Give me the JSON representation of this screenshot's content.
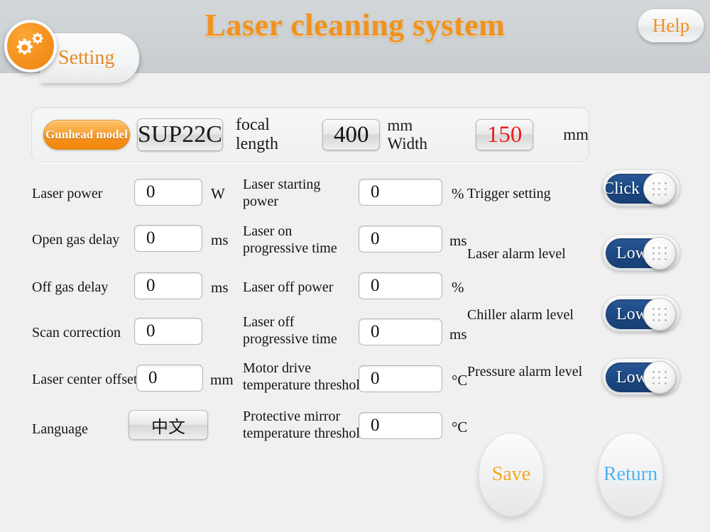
{
  "header": {
    "title": "Laser cleaning system",
    "help_label": "Help",
    "tab_label": "Setting",
    "gear_icon": "gears-icon",
    "accent_orange": "#f0921e",
    "bar_color": "#cdd2d5"
  },
  "param_panel": {
    "gunhead_model_label": "Gunhead model",
    "gunhead_model_value": "SUP22C",
    "focal_length_label": "focal length",
    "focal_length_value": "400",
    "focal_length_unit": "mm Width",
    "width_value": "150",
    "width_value_color": "#f01c1c",
    "width_unit": "mm"
  },
  "left_fields": [
    {
      "label": "Laser power",
      "value": "0",
      "unit": "W"
    },
    {
      "label": "Open gas delay",
      "value": "0",
      "unit": "ms"
    },
    {
      "label": "Off gas delay",
      "value": "0",
      "unit": "ms"
    },
    {
      "label": "Scan correction",
      "value": "0",
      "unit": ""
    },
    {
      "label": "Laser center offset",
      "value": "0",
      "unit": "mm"
    }
  ],
  "language_row": {
    "label": "Language",
    "button_label": "中文"
  },
  "middle_fields": [
    {
      "label": "Laser starting\npower",
      "value": "0",
      "unit": "%"
    },
    {
      "label": "Laser on\nprogressive time",
      "value": "0",
      "unit": "ms"
    },
    {
      "label": "Laser off power",
      "value": "0",
      "unit": "%"
    },
    {
      "label": "Laser off\nprogressive time",
      "value": "0",
      "unit": "ms"
    },
    {
      "label": "Motor drive\ntemperature threshold",
      "value": "0",
      "unit": "°C"
    },
    {
      "label": "Protective mirror\ntemperature threshold",
      "value": "0",
      "unit": "°C"
    }
  ],
  "toggles": [
    {
      "label": "Trigger setting",
      "state": "Click on"
    },
    {
      "label": "Laser alarm level",
      "state": "Low"
    },
    {
      "label": "Chiller alarm level",
      "state": "Low"
    },
    {
      "label": "Pressure alarm level",
      "state": "Low"
    }
  ],
  "actions": {
    "save_label": "Save",
    "save_color": "#f0a81e",
    "return_label": "Return",
    "return_color": "#4eb3f0"
  }
}
